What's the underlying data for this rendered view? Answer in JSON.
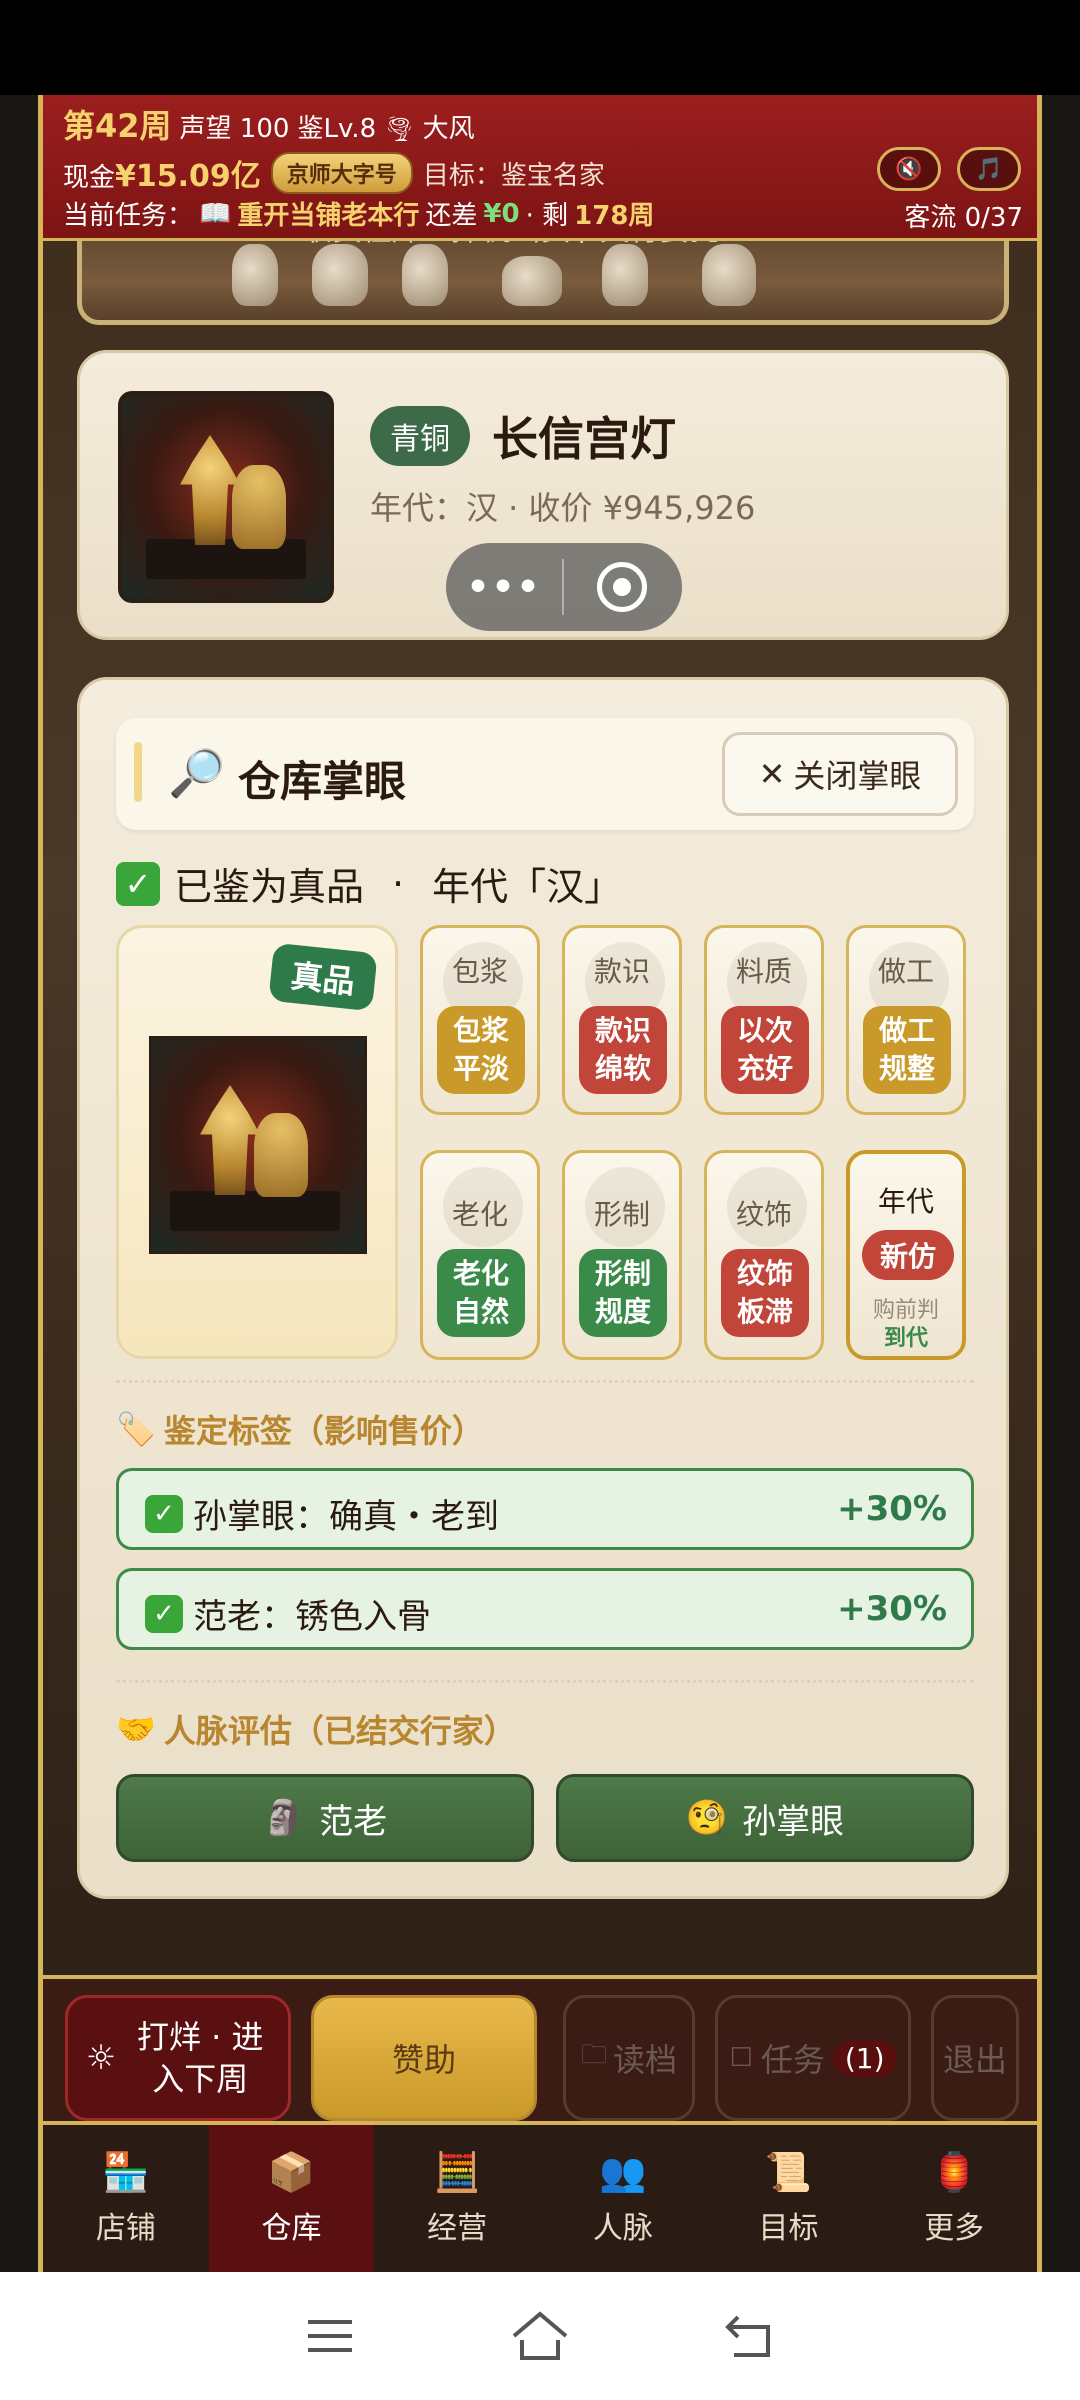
{
  "header": {
    "week": "第42周",
    "reputation": "声望 100",
    "appraisal_level": "鉴Lv.8",
    "weather": "大风",
    "cash_label": "现金",
    "cash_value": "¥15.09亿",
    "font_badge": "京师大字号",
    "goal": "目标：鉴宝名家",
    "task_label": "当前任务：",
    "task_name": "重开当铺老本行",
    "task_gap_label": "还差",
    "task_gap_value": "¥0",
    "task_remain_label": "· 剩",
    "task_remain_value": "178周",
    "traffic": "客流 0/37"
  },
  "shelf": {
    "caption": "收货在库 · 择机出货 / 文行要托"
  },
  "item": {
    "material_tag": "青铜",
    "name": "长信宫灯",
    "meta": "年代：汉   ·   收价 ¥945,926"
  },
  "panel": {
    "title": "仓库掌眼",
    "close_label": "关闭掌眼",
    "verdict_text": "已鉴为真品",
    "verdict_sep": "·",
    "verdict_era": "年代「汉」",
    "authentic_badge": "真品",
    "attributes": [
      {
        "name": "包浆",
        "result": "包浆平淡",
        "tone": "gold"
      },
      {
        "name": "款识",
        "result": "款识绵软",
        "tone": "red"
      },
      {
        "name": "料质",
        "result": "以次充好",
        "tone": "red"
      },
      {
        "name": "做工",
        "result": "做工规整",
        "tone": "gold"
      },
      {
        "name": "老化",
        "result": "老化自然",
        "tone": "green"
      },
      {
        "name": "形制",
        "result": "形制规度",
        "tone": "green"
      },
      {
        "name": "纹饰",
        "result": "纹饰板滞",
        "tone": "red"
      }
    ],
    "era_tile": {
      "name": "年代",
      "result": "新仿",
      "note": "购前判",
      "note2": "到代"
    },
    "tags_heading": "鉴定标签（影响售价）",
    "tags": [
      {
        "text": "孙掌眼：确真・老到",
        "bonus": "+30%"
      },
      {
        "text": "范老：锈色入骨",
        "bonus": "+30%"
      }
    ],
    "contacts_heading": "人脉评估（已结交行家）",
    "contacts": [
      {
        "label": "范老",
        "icon": "🗿"
      },
      {
        "label": "孙掌眼",
        "icon": "🧐"
      }
    ]
  },
  "actions": {
    "next_week": "打烊 · 进入下周",
    "sponsor": "赞助",
    "load": "读档",
    "tasks": "任务",
    "tasks_count": "(1)",
    "exit": "退出"
  },
  "tabs": [
    {
      "label": "店铺",
      "icon": "🏪"
    },
    {
      "label": "仓库",
      "icon": "📦"
    },
    {
      "label": "经营",
      "icon": "🧮"
    },
    {
      "label": "人脉",
      "icon": "👥"
    },
    {
      "label": "目标",
      "icon": "📜"
    },
    {
      "label": "更多",
      "icon": "🏮"
    }
  ],
  "colors": {
    "header_red": "#9c1e1e",
    "gold": "#d6b45a",
    "green": "#3d6b4a",
    "panel": "#f4ecdc"
  }
}
